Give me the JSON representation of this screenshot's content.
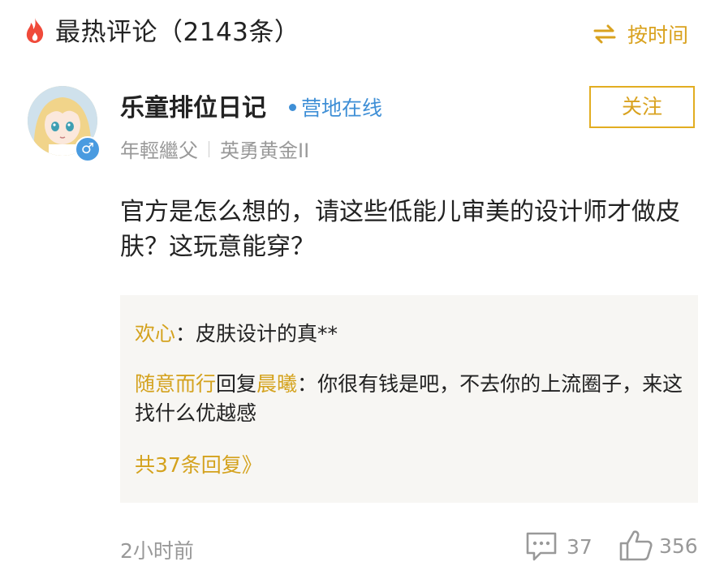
{
  "header": {
    "title": "最热评论（2143条）",
    "fire_icon": "fire-icon",
    "sort_label": "按时间",
    "sort_icon": "swap-arrows-icon"
  },
  "comment": {
    "user": {
      "name": "乐童排位日记",
      "online_status": "营地在线",
      "gender_symbol": "♂",
      "tag": "年輕繼父",
      "rank": "英勇黄金II",
      "follow_label": "关注"
    },
    "text": "官方是怎么想的，请这些低能儿审美的设计师才做皮肤？这玩意能穿？",
    "replies": [
      {
        "author": "欢心",
        "colon": "：",
        "text": "皮肤设计的真**"
      },
      {
        "author": "随意而行",
        "reply_word": "回复",
        "target": "晨曦",
        "colon": "：",
        "text": "你很有钱是吧，不去你的上流圈子，来这找什么优越感"
      }
    ],
    "more_replies": "共37条回复》",
    "time": "2小时前",
    "reply_count": "37",
    "like_count": "356"
  },
  "colors": {
    "accent_gold": "#d9a21f",
    "online_blue": "#3f8fd6",
    "fire_red": "#f04a3a",
    "muted_gray": "#999999"
  }
}
